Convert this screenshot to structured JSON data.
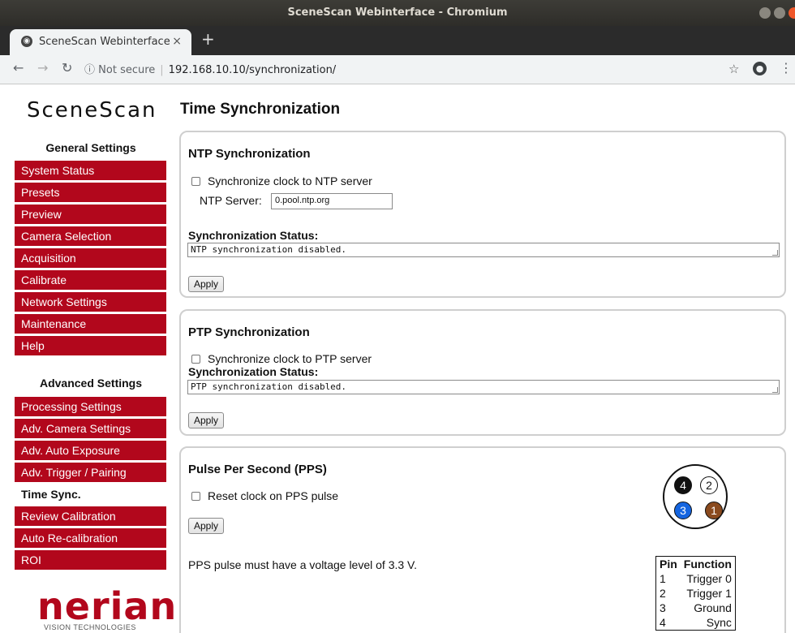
{
  "window": {
    "title": "SceneScan Webinterface - Chromium"
  },
  "browser": {
    "tab_label": "SceneScan Webinterface",
    "tab_close": "×",
    "new_tab": "+",
    "security": "Not secure",
    "url": "192.168.10.10/synchronization/"
  },
  "sidebar": {
    "logo": "SceneScan",
    "general_title": "General Settings",
    "general_items": [
      "System Status",
      "Presets",
      "Preview",
      "Camera Selection",
      "Acquisition",
      "Calibrate",
      "Network Settings",
      "Maintenance",
      "Help"
    ],
    "advanced_title": "Advanced Settings",
    "advanced_items": [
      "Processing Settings",
      "Adv. Camera Settings",
      "Adv. Auto Exposure",
      "Adv. Trigger / Pairing",
      "Time Sync.",
      "Review Calibration",
      "Auto Re-calibration",
      "ROI"
    ],
    "active_item": "Time Sync.",
    "brand": "nerian",
    "brand_sub": "VISION TECHNOLOGIES"
  },
  "main": {
    "title": "Time Synchronization",
    "ntp": {
      "title": "NTP Synchronization",
      "checkbox_label": "Synchronize clock to NTP server",
      "checked": false,
      "server_label": "NTP Server:",
      "server_value": "0.pool.ntp.org",
      "status_label": "Synchronization Status:",
      "status_text": "NTP synchronization disabled.",
      "apply": "Apply"
    },
    "ptp": {
      "title": "PTP Synchronization",
      "checkbox_label": "Synchronize clock to PTP server",
      "checked": false,
      "status_label": "Synchronization Status:",
      "status_text": "PTP synchronization disabled.",
      "apply": "Apply"
    },
    "pps": {
      "title": "Pulse Per Second (PPS)",
      "checkbox_label": "Reset clock on PPS pulse",
      "checked": false,
      "apply": "Apply",
      "note": "PPS pulse must have a voltage level of 3.3 V.",
      "connector_pins": [
        {
          "label": "4",
          "color": "#111111"
        },
        {
          "label": "2",
          "color": "#ffffff"
        },
        {
          "label": "3",
          "color": "#1565e0"
        },
        {
          "label": "1",
          "color": "#8a4a1e"
        }
      ],
      "table_headers": [
        "Pin",
        "Function"
      ],
      "table_rows": [
        [
          "1",
          "Trigger 0"
        ],
        [
          "2",
          "Trigger 1"
        ],
        [
          "3",
          "Ground"
        ],
        [
          "4",
          "Sync"
        ]
      ]
    }
  }
}
